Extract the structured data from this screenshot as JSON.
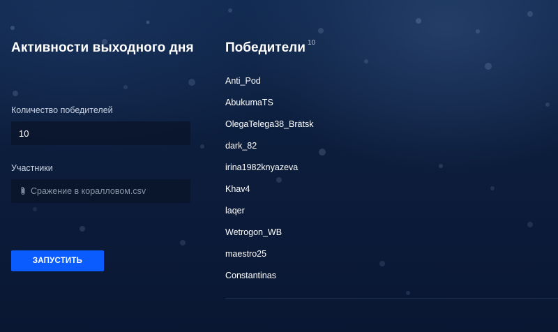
{
  "left": {
    "title": "Активности выходного дня",
    "count_label": "Количество победителей",
    "count_value": "10",
    "participants_label": "Участники",
    "file_name": "Сражение в коралловом.csv",
    "file_icon": "paperclip-icon",
    "run_button": "ЗАПУСТИТЬ"
  },
  "right": {
    "title": "Победители",
    "count": "10",
    "winners": [
      "Anti_Pod",
      "AbukumaTS",
      "OlegaTelega38_Bratsk",
      "dark_82",
      "irina1982knyazeva",
      "Khav4",
      "laqer",
      "Wetrogon_WB",
      "maestro25",
      "Constantinas"
    ]
  },
  "colors": {
    "background": "#0c1d3c",
    "input_background": "#0a1428",
    "accent": "#0a5cff",
    "muted_text": "#8993a6"
  }
}
